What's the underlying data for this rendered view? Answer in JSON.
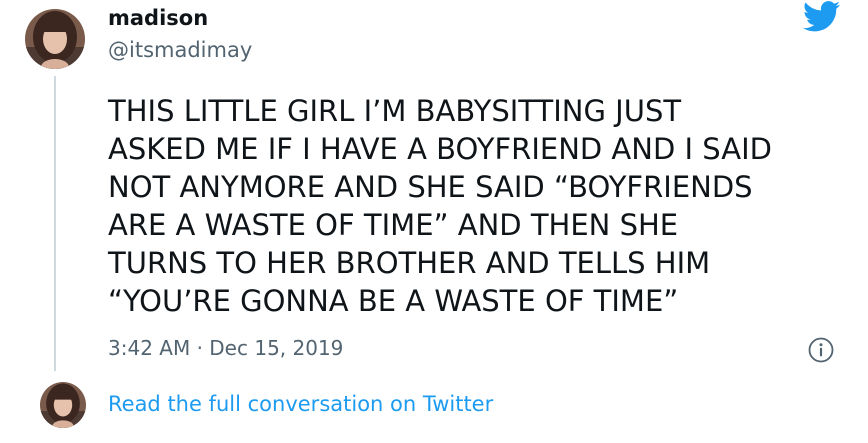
{
  "author": {
    "name": "madison",
    "handle": "@itsmadimay"
  },
  "tweet": {
    "lines": [
      "THIS LITTLE GIRL I’M BABYSITTING JUST",
      "ASKED ME IF I HAVE A BOYFRIEND AND I SAID",
      "NOT ANYMORE AND SHE SAID “BOYFRIENDS",
      "ARE A WASTE OF TIME” AND THEN SHE",
      "TURNS TO HER BROTHER AND TELLS HIM",
      "“YOU’RE GONNA BE A WASTE OF TIME”"
    ],
    "timestamp": "3:42 AM · Dec 15, 2019"
  },
  "footer": {
    "read_more_label": "Read the full conversation on Twitter"
  },
  "icons": {
    "brand": "twitter-bird-icon",
    "info": "info-icon"
  },
  "colors": {
    "brand_blue": "#1d9bf0",
    "secondary_text": "#536471",
    "thread_line": "#cfd9de"
  }
}
